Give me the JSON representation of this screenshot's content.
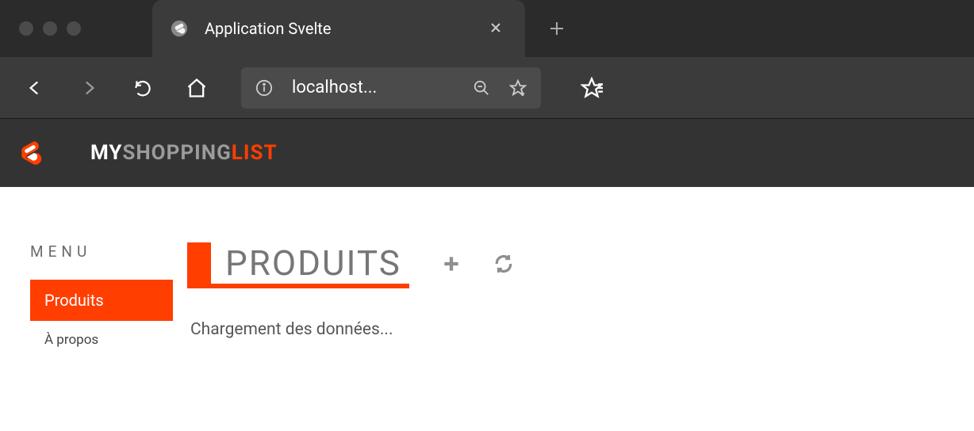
{
  "browser": {
    "tab_title": "Application Svelte",
    "url_display": "localhost..."
  },
  "app": {
    "title_my": "MY",
    "title_shopping": "SHOPPING",
    "title_list": "LIST"
  },
  "sidebar": {
    "menu_label": "MENU",
    "items": [
      {
        "label": "Produits",
        "active": true
      },
      {
        "label": "À propos",
        "active": false
      }
    ]
  },
  "content": {
    "page_title": "PRODUITS",
    "loading_text": "Chargement des données..."
  }
}
